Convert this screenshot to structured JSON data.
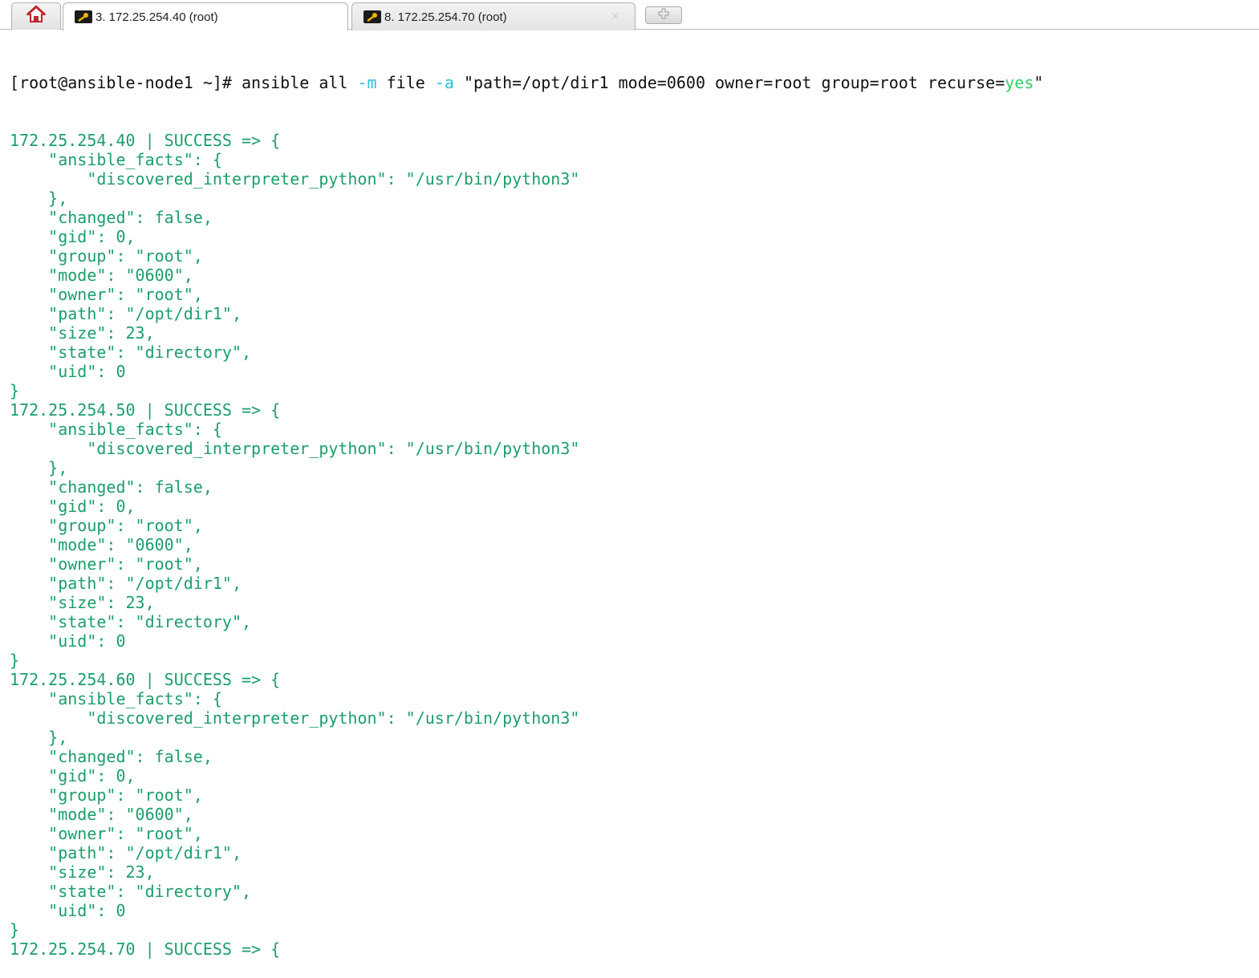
{
  "tabs": [
    {
      "label": "3. 172.25.254.40 (root)",
      "active": true
    },
    {
      "label": "8. 172.25.254.70 (root)",
      "active": false
    }
  ],
  "icons": {
    "home": "home-icon",
    "tab": "key-icon",
    "close": "close-icon",
    "new_tab": "new-tab-icon"
  },
  "colors": {
    "output_text": "#1a9f6a",
    "command_text": "#111111",
    "flag": "#27c0e0",
    "yes": "#2fd067"
  },
  "terminal": {
    "command": {
      "prompt": "[root@ansible-node1 ~]# ",
      "cmd1": "ansible all ",
      "flag_m": "-m",
      "mid": " file ",
      "flag_a": "-a",
      "args": " \"path=/opt/dir1 mode=0600 owner=root group=root recurse=",
      "yes": "yes",
      "end": "\""
    },
    "output_lines": [
      "172.25.254.40 | SUCCESS => {",
      "    \"ansible_facts\": {",
      "        \"discovered_interpreter_python\": \"/usr/bin/python3\"",
      "    },",
      "    \"changed\": false,",
      "    \"gid\": 0,",
      "    \"group\": \"root\",",
      "    \"mode\": \"0600\",",
      "    \"owner\": \"root\",",
      "    \"path\": \"/opt/dir1\",",
      "    \"size\": 23,",
      "    \"state\": \"directory\",",
      "    \"uid\": 0",
      "}",
      "172.25.254.50 | SUCCESS => {",
      "    \"ansible_facts\": {",
      "        \"discovered_interpreter_python\": \"/usr/bin/python3\"",
      "    },",
      "    \"changed\": false,",
      "    \"gid\": 0,",
      "    \"group\": \"root\",",
      "    \"mode\": \"0600\",",
      "    \"owner\": \"root\",",
      "    \"path\": \"/opt/dir1\",",
      "    \"size\": 23,",
      "    \"state\": \"directory\",",
      "    \"uid\": 0",
      "}",
      "172.25.254.60 | SUCCESS => {",
      "    \"ansible_facts\": {",
      "        \"discovered_interpreter_python\": \"/usr/bin/python3\"",
      "    },",
      "    \"changed\": false,",
      "    \"gid\": 0,",
      "    \"group\": \"root\",",
      "    \"mode\": \"0600\",",
      "    \"owner\": \"root\",",
      "    \"path\": \"/opt/dir1\",",
      "    \"size\": 23,",
      "    \"state\": \"directory\",",
      "    \"uid\": 0",
      "}",
      "172.25.254.70 | SUCCESS => {"
    ]
  }
}
